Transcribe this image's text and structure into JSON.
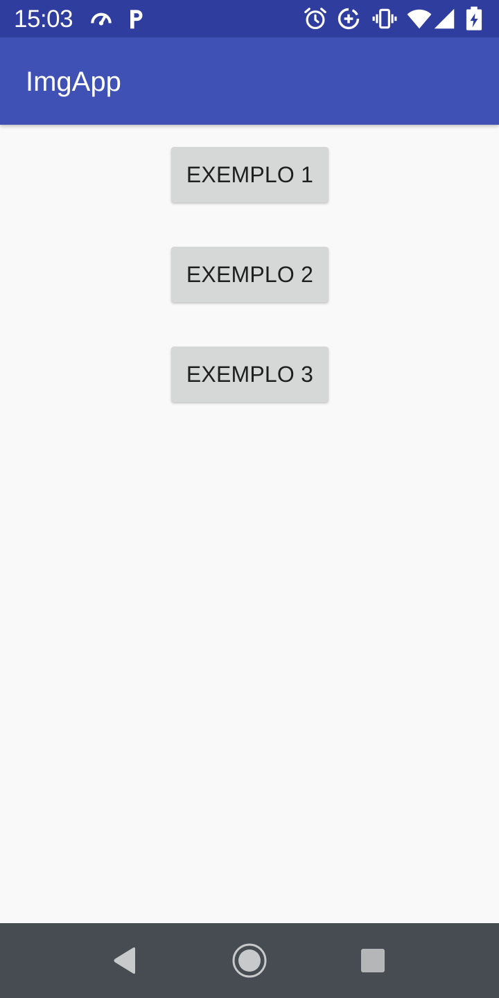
{
  "status_bar": {
    "time": "15:03",
    "icons": [
      "speedometer-icon",
      "parking-icon",
      "alarm-icon",
      "data-saver-icon",
      "vibrate-icon",
      "wifi-icon",
      "signal-icon",
      "battery-charging-icon"
    ]
  },
  "app_bar": {
    "title": "ImgApp",
    "color": "#3f51b5"
  },
  "main": {
    "buttons": [
      {
        "label": "EXEMPLO 1"
      },
      {
        "label": "EXEMPLO 2"
      },
      {
        "label": "EXEMPLO 3"
      }
    ]
  },
  "nav_bar": {
    "icons": [
      "back-icon",
      "home-icon",
      "recents-icon"
    ]
  },
  "colors": {
    "status_bar": "#2f3e9e",
    "app_bar": "#3f51b5",
    "background": "#f9f9f9",
    "button": "#d6d7d7",
    "nav_bar": "#464c52"
  }
}
